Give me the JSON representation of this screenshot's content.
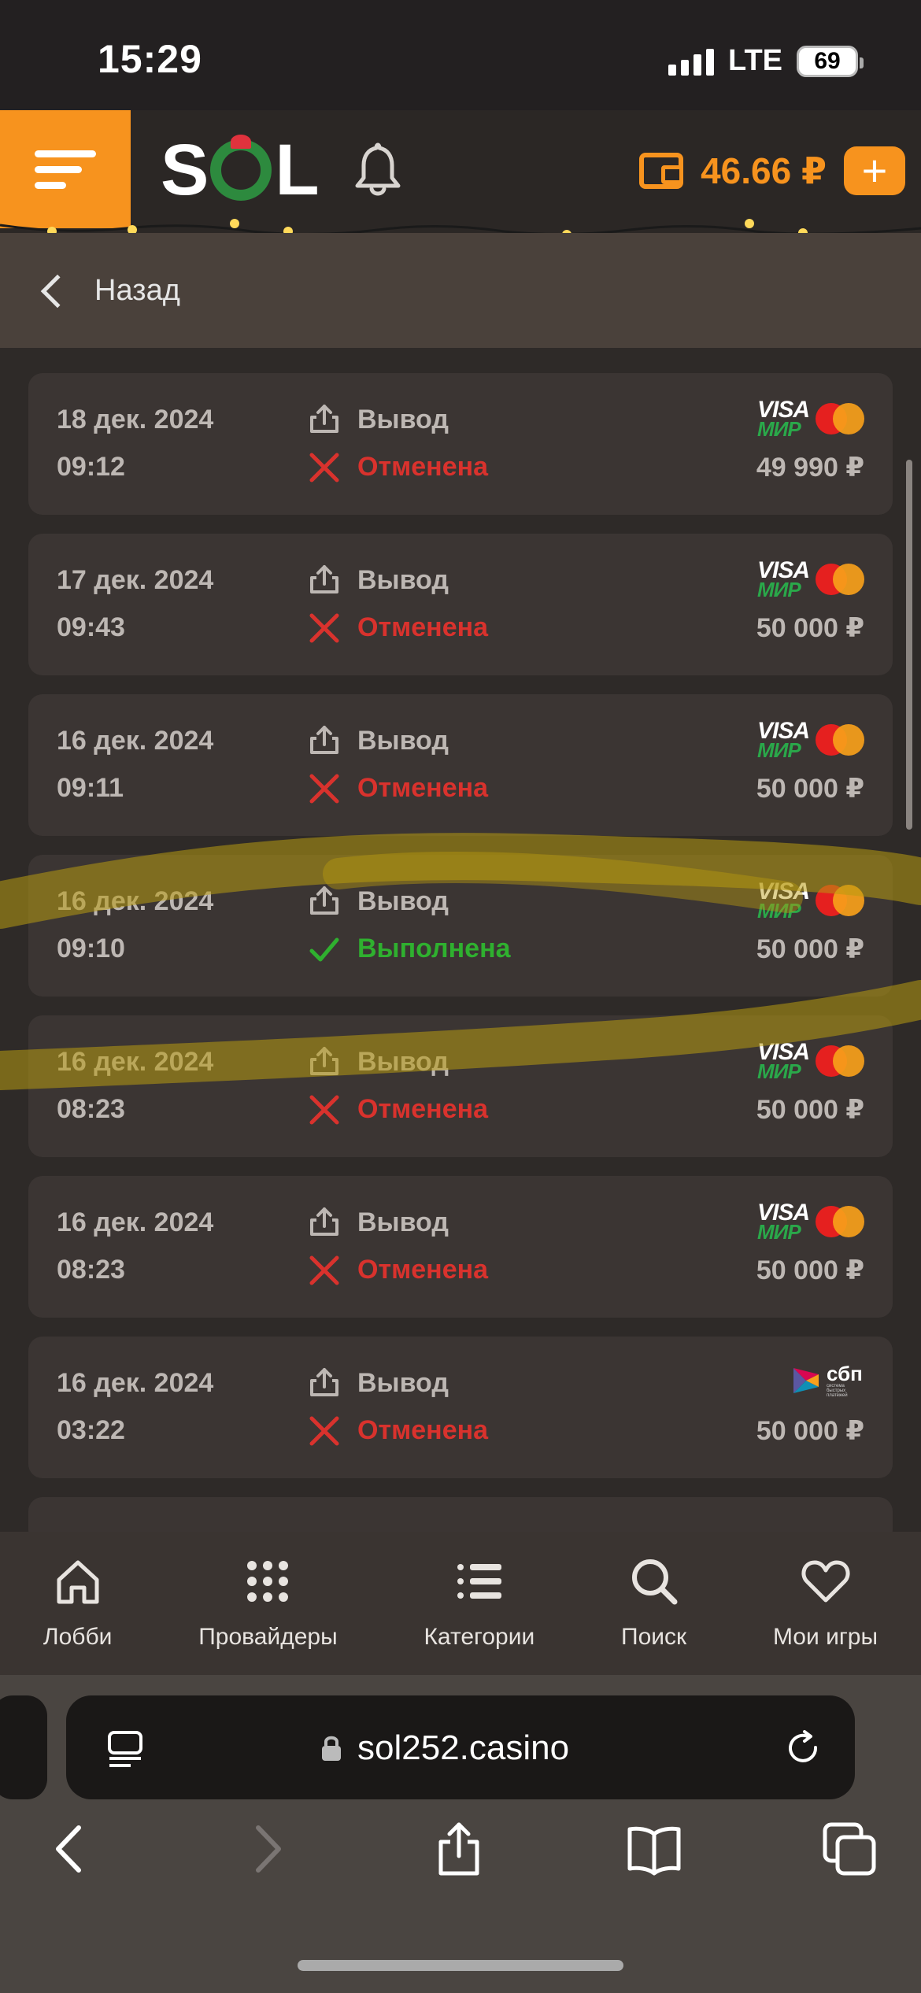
{
  "status_bar": {
    "time": "15:29",
    "network": "LTE",
    "battery": "69"
  },
  "header": {
    "brand": "SOL",
    "balance": "46.66 ₽",
    "add_label": "+"
  },
  "back": {
    "label": "Назад"
  },
  "transactions": [
    {
      "date": "18 дек. 2024",
      "time": "09:12",
      "type": "Вывод",
      "status": "Отменена",
      "status_kind": "cancelled",
      "amount": "49 990 ₽",
      "method": "visa-mir-mastercard"
    },
    {
      "date": "17 дек. 2024",
      "time": "09:43",
      "type": "Вывод",
      "status": "Отменена",
      "status_kind": "cancelled",
      "amount": "50 000 ₽",
      "method": "visa-mir-mastercard"
    },
    {
      "date": "16 дек. 2024",
      "time": "09:11",
      "type": "Вывод",
      "status": "Отменена",
      "status_kind": "cancelled",
      "amount": "50 000 ₽",
      "method": "visa-mir-mastercard"
    },
    {
      "date": "16 дек. 2024",
      "time": "09:10",
      "type": "Вывод",
      "status": "Выполнена",
      "status_kind": "done",
      "amount": "50 000 ₽",
      "method": "visa-mir-mastercard"
    },
    {
      "date": "16 дек. 2024",
      "time": "08:23",
      "type": "Вывод",
      "status": "Отменена",
      "status_kind": "cancelled",
      "amount": "50 000 ₽",
      "method": "visa-mir-mastercard"
    },
    {
      "date": "16 дек. 2024",
      "time": "08:23",
      "type": "Вывод",
      "status": "Отменена",
      "status_kind": "cancelled",
      "amount": "50 000 ₽",
      "method": "visa-mir-mastercard"
    },
    {
      "date": "16 дек. 2024",
      "time": "03:22",
      "type": "Вывод",
      "status": "Отменена",
      "status_kind": "cancelled",
      "amount": "50 000 ₽",
      "method": "sbp"
    }
  ],
  "logos": {
    "visa": "VISA",
    "mir": "МИР",
    "sbp": "сбп",
    "sbp_caption": "система быстрых платежей"
  },
  "bottom_nav": [
    {
      "label": "Лобби",
      "icon": "home-icon"
    },
    {
      "label": "Провайдеры",
      "icon": "grid-icon"
    },
    {
      "label": "Категории",
      "icon": "list-icon"
    },
    {
      "label": "Поиск",
      "icon": "search-icon"
    },
    {
      "label": "Мои игры",
      "icon": "heart-icon"
    }
  ],
  "browser": {
    "url": "sol252.casino"
  },
  "colors": {
    "accent": "#f7931e",
    "cancelled": "#d9322d",
    "done": "#2fb02f",
    "card": "#3b3533"
  }
}
